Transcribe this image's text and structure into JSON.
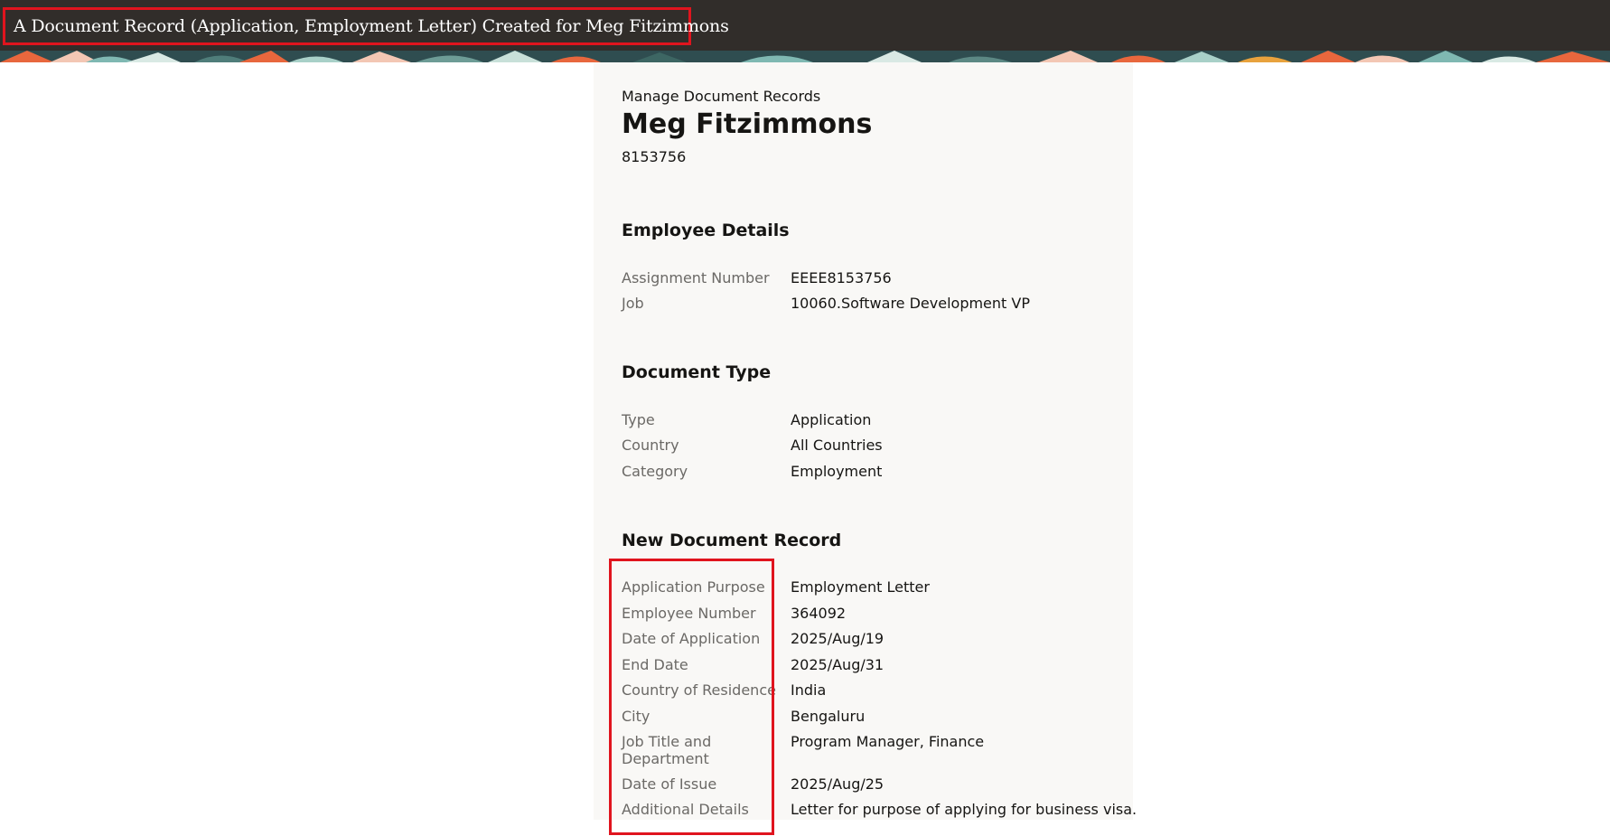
{
  "header": {
    "title": "A Document Record (Application, Employment Letter) Created for Meg Fitzimmons"
  },
  "colors": {
    "topbar": "#312d2a",
    "highlight": "#e0141e",
    "panel": "#f9f8f6",
    "label": "#6b6966"
  },
  "page": {
    "breadcrumb": "Manage Document Records",
    "person_name": "Meg Fitzimmons",
    "person_number": "8153756"
  },
  "employee_details": {
    "heading": "Employee Details",
    "fields": [
      {
        "label": "Assignment Number",
        "value": "EEEE8153756"
      },
      {
        "label": "Job",
        "value": "10060.Software Development VP"
      }
    ]
  },
  "document_type": {
    "heading": "Document Type",
    "fields": [
      {
        "label": "Type",
        "value": "Application"
      },
      {
        "label": "Country",
        "value": "All Countries"
      },
      {
        "label": "Category",
        "value": "Employment"
      }
    ]
  },
  "new_document_record": {
    "heading": "New Document Record",
    "fields": [
      {
        "label": "Application Purpose",
        "value": "Employment Letter"
      },
      {
        "label": "Employee Number",
        "value": "364092"
      },
      {
        "label": "Date of Application",
        "value": "2025/Aug/19"
      },
      {
        "label": "End Date",
        "value": "2025/Aug/31"
      },
      {
        "label": "Country of Residence",
        "value": "India"
      },
      {
        "label": "City",
        "value": "Bengaluru"
      },
      {
        "label": "Job Title and Department",
        "value": "Program Manager, Finance"
      },
      {
        "label": "Date of Issue",
        "value": "2025/Aug/25"
      },
      {
        "label": "Additional Details",
        "value": "Letter for purpose of applying for business visa."
      }
    ]
  }
}
